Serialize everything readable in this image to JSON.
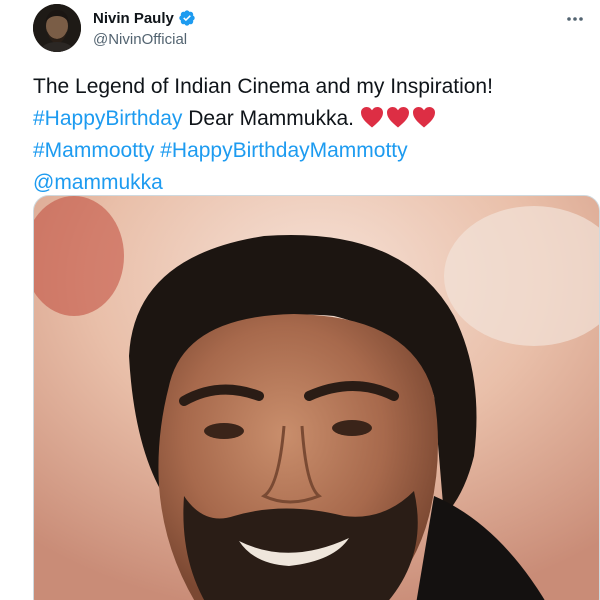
{
  "tweet": {
    "author_name": "Nivin Pauly",
    "author_handle": "@NivinOfficial",
    "verified": true,
    "text_line1": "The Legend of Indian Cinema and my Inspiration!",
    "hashtag_birthday": "#HappyBirthday",
    "text_dear": " Dear Mammukka.",
    "hearts_count": 3,
    "hashtag_mammootty": "#Mammootty",
    "hashtag_birthday_mammootty": "#HappyBirthdayMammotty",
    "mention": "@mammukka"
  },
  "icons": {
    "verified": "verified-badge-icon",
    "more": "more-options-icon",
    "heart": "red-heart-emoji"
  },
  "colors": {
    "link": "#1d9bf0",
    "handle": "#536471",
    "text": "#0f1419",
    "verified": "#1d9bf0",
    "heart": "#dd2e44"
  }
}
